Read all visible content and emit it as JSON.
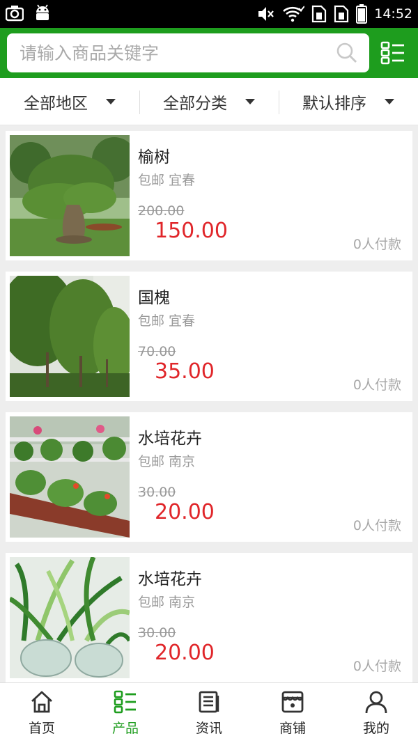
{
  "status_bar": {
    "time": "14:52",
    "left_icons": [
      "camera-icon",
      "android-icon"
    ],
    "right_icons": [
      "mute-icon",
      "wifi-icon",
      "sim1-icon",
      "sim2-icon",
      "battery-icon"
    ]
  },
  "search": {
    "placeholder": "请输入商品关键字",
    "value": ""
  },
  "filters": [
    {
      "label": "全部地区"
    },
    {
      "label": "全部分类"
    },
    {
      "label": "默认排序"
    }
  ],
  "products": [
    {
      "title": "榆树",
      "tag": "包邮 宜春",
      "old_price": "200.00",
      "price": "150.00",
      "paid": "0人付款"
    },
    {
      "title": "国槐",
      "tag": "包邮 宜春",
      "old_price": "70.00",
      "price": "35.00",
      "paid": "0人付款"
    },
    {
      "title": "水培花卉",
      "tag": "包邮 南京",
      "old_price": "30.00",
      "price": "20.00",
      "paid": "0人付款"
    },
    {
      "title": "水培花卉",
      "tag": "包邮 南京",
      "old_price": "30.00",
      "price": "20.00",
      "paid": "0人付款"
    }
  ],
  "nav": [
    {
      "label": "首页",
      "icon": "home-icon"
    },
    {
      "label": "产品",
      "icon": "grid-list-icon",
      "active": true
    },
    {
      "label": "资讯",
      "icon": "news-icon"
    },
    {
      "label": "商铺",
      "icon": "shop-icon"
    },
    {
      "label": "我的",
      "icon": "user-icon"
    }
  ],
  "colors": {
    "brand_green": "#1e9d1e",
    "price_red": "#e0262a"
  }
}
